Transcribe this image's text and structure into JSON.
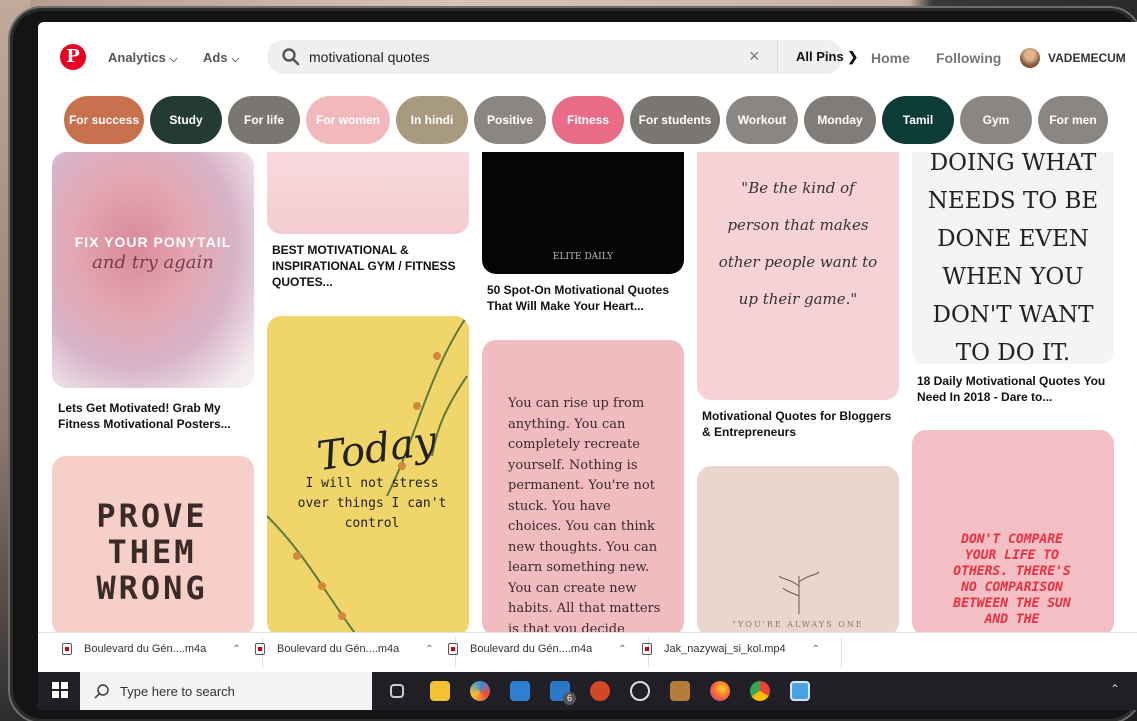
{
  "header": {
    "logo": "P",
    "analytics": "Analytics",
    "ads": "Ads",
    "search_value": "motivational quotes",
    "clear_symbol": "×",
    "filter": "All Pins",
    "home": "Home",
    "following": "Following",
    "user": "VADEMECUM"
  },
  "chips": [
    {
      "label": "For success",
      "color": "#c9714f"
    },
    {
      "label": "Study",
      "color": "#243a34"
    },
    {
      "label": "For life",
      "color": "#7a7672"
    },
    {
      "label": "For women",
      "color": "#f2b9bd"
    },
    {
      "label": "In hindi",
      "color": "#a89a7f"
    },
    {
      "label": "Positive",
      "color": "#8a8684"
    },
    {
      "label": "Fitness",
      "color": "#e86b87"
    },
    {
      "label": "For students",
      "color": "#7a7672"
    },
    {
      "label": "Workout",
      "color": "#8a8684"
    },
    {
      "label": "Monday",
      "color": "#7f7c7a"
    },
    {
      "label": "Tamil",
      "color": "#0d3b35"
    },
    {
      "label": "Gym",
      "color": "#8a8684"
    },
    {
      "label": "For men",
      "color": "#8a8684"
    }
  ],
  "pins": {
    "p1_text1": "FIX YOUR PONYTAIL",
    "p1_text2": "and try again",
    "p1_caption": "Lets Get Motivated! Grab My Fitness Motivational Posters...",
    "p2_caption": "BEST MOTIVATIONAL & INSPIRATIONAL GYM / FITNESS QUOTES...",
    "p3_brand": "ELITE DAILY",
    "p3_caption": "50 Spot-On Motivational Quotes That Will Make Your Heart...",
    "p4_quote": "\"Be the kind of person that makes other people want to up their game.\"",
    "p4_caption": "Motivational Quotes for Bloggers & Entrepreneurs",
    "p5_quote": "DOING WHAT NEEDS TO BE DONE EVEN WHEN YOU DON'T WANT TO DO IT.",
    "p5_caption": "18 Daily Motivational Quotes You Need In 2018 - Dare to...",
    "p6_text": "PROVE THEM WRONG",
    "p7_title": "Today",
    "p7_text": "I will not stress over things I can't control",
    "p8_text": "You can rise up from anything. You can completely recreate yourself. Nothing is permanent. You're not stuck. You have choices. You can think new thoughts. You can learn something new. You can create new habits. All that matters is that you decide today and never look back",
    "p9_text": "\"YOU'RE ALWAYS ONE",
    "p10_text": "DON'T COMPARE YOUR LIFE TO OTHERS. THERE'S NO COMPARISON BETWEEN THE SUN AND THE"
  },
  "downloads": [
    {
      "name": "Boulevard du Gén....m4a"
    },
    {
      "name": "Boulevard du Gén....m4a"
    },
    {
      "name": "Boulevard du Gén....m4a"
    },
    {
      "name": "Jak_nazywaj_si_kol.mp4"
    }
  ],
  "taskbar": {
    "search_placeholder": "Type here to search",
    "mail_badge": "6"
  }
}
